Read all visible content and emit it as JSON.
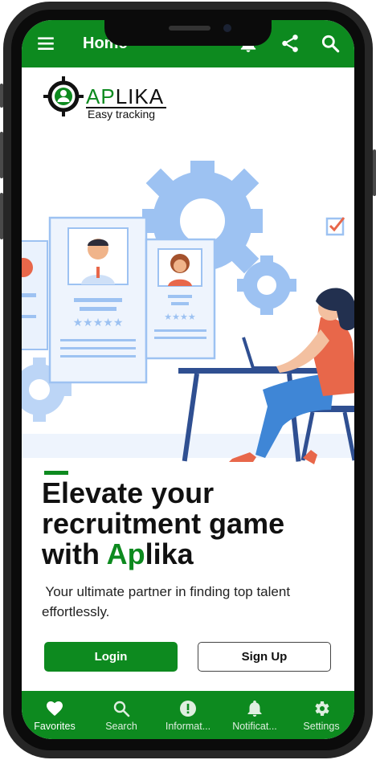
{
  "app_bar": {
    "title": "Home",
    "icons": [
      "menu-icon",
      "bell-icon",
      "share-icon",
      "search-icon"
    ]
  },
  "logo": {
    "brand_ap": "AP",
    "brand_lika": "LIKA",
    "tagline": "Easy tracking"
  },
  "hero": {
    "headline_line1": "Elevate your",
    "headline_line2": "recruitment game",
    "headline_with": "with ",
    "headline_brand_green": "Ap",
    "headline_brand_rest": "lika",
    "subtitle_line1": " Your ultimate partner in finding top talent",
    "subtitle_line2": "effortlessly."
  },
  "buttons": {
    "login": "Login",
    "signup": "Sign Up"
  },
  "bottom_nav": {
    "tabs": [
      {
        "label": "Favorites",
        "icon": "heart-icon",
        "active": true
      },
      {
        "label": "Search",
        "icon": "search-icon",
        "active": false
      },
      {
        "label": "Informat...",
        "icon": "info-icon",
        "active": false
      },
      {
        "label": "Notificat...",
        "icon": "bell-icon",
        "active": false
      },
      {
        "label": "Settings",
        "icon": "gear-icon",
        "active": false
      }
    ]
  },
  "colors": {
    "primary_green": "#0d8a1f",
    "illustration_blue": "#9dc2f2",
    "accent_orange": "#e8674a"
  }
}
